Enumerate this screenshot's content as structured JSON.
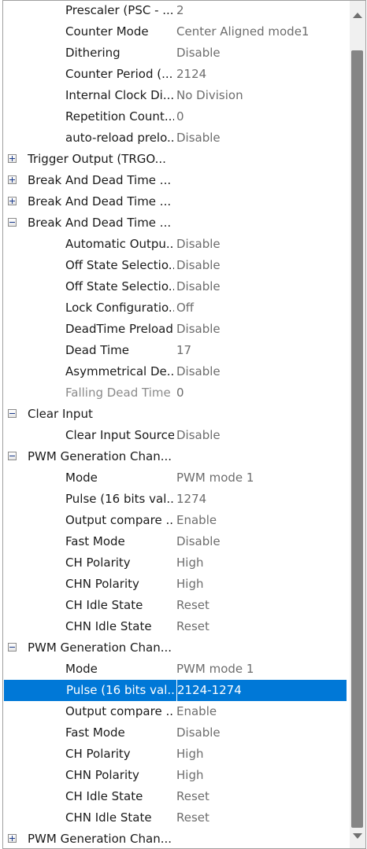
{
  "rows": [
    {
      "type": "prop",
      "label": "Prescaler (PSC - ...",
      "value": "2"
    },
    {
      "type": "prop",
      "label": "Counter Mode",
      "value": "Center Aligned mode1"
    },
    {
      "type": "prop",
      "label": "Dithering",
      "value": "Disable"
    },
    {
      "type": "prop",
      "label": "Counter Period (...",
      "value": "2124"
    },
    {
      "type": "prop",
      "label": "Internal Clock Di...",
      "value": "No Division"
    },
    {
      "type": "prop",
      "label": "Repetition Count...",
      "value": "0"
    },
    {
      "type": "prop",
      "label": "auto-reload prelo...",
      "value": "Disable"
    },
    {
      "type": "group",
      "label": "Trigger Output (TRGO...",
      "expanded": false
    },
    {
      "type": "group",
      "label": "Break And Dead Time ...",
      "expanded": false
    },
    {
      "type": "group",
      "label": "Break And Dead Time ...",
      "expanded": false
    },
    {
      "type": "group",
      "label": "Break And Dead Time ...",
      "expanded": true
    },
    {
      "type": "prop",
      "label": "Automatic Outpu...",
      "value": "Disable"
    },
    {
      "type": "prop",
      "label": "Off State Selectio...",
      "value": "Disable"
    },
    {
      "type": "prop",
      "label": "Off State Selectio...",
      "value": "Disable"
    },
    {
      "type": "prop",
      "label": "Lock Configuratio...",
      "value": "Off"
    },
    {
      "type": "prop",
      "label": "DeadTime Preload",
      "value": "Disable"
    },
    {
      "type": "prop",
      "label": "Dead Time",
      "value": "17"
    },
    {
      "type": "prop",
      "label": "Asymmetrical De...",
      "value": "Disable"
    },
    {
      "type": "prop",
      "label": "Falling Dead Time",
      "value": "0",
      "disabled": true
    },
    {
      "type": "group",
      "label": "Clear Input",
      "expanded": true
    },
    {
      "type": "prop",
      "label": "Clear Input Source",
      "value": "Disable"
    },
    {
      "type": "group",
      "label": "PWM Generation Chan...",
      "expanded": true
    },
    {
      "type": "prop",
      "label": "Mode",
      "value": "PWM mode 1"
    },
    {
      "type": "prop",
      "label": "Pulse (16 bits val...",
      "value": "1274"
    },
    {
      "type": "prop",
      "label": "Output compare ...",
      "value": "Enable"
    },
    {
      "type": "prop",
      "label": "Fast Mode",
      "value": "Disable"
    },
    {
      "type": "prop",
      "label": "CH Polarity",
      "value": "High"
    },
    {
      "type": "prop",
      "label": "CHN Polarity",
      "value": "High"
    },
    {
      "type": "prop",
      "label": "CH Idle State",
      "value": "Reset"
    },
    {
      "type": "prop",
      "label": "CHN Idle State",
      "value": "Reset"
    },
    {
      "type": "group",
      "label": "PWM Generation Chan...",
      "expanded": true
    },
    {
      "type": "prop",
      "label": "Mode",
      "value": "PWM mode 1"
    },
    {
      "type": "prop",
      "label": "Pulse (16 bits val...",
      "value": "2124-1274",
      "selected": true
    },
    {
      "type": "prop",
      "label": "Output compare ...",
      "value": "Enable"
    },
    {
      "type": "prop",
      "label": "Fast Mode",
      "value": "Disable"
    },
    {
      "type": "prop",
      "label": "CH Polarity",
      "value": "High"
    },
    {
      "type": "prop",
      "label": "CHN Polarity",
      "value": "High"
    },
    {
      "type": "prop",
      "label": "CH Idle State",
      "value": "Reset"
    },
    {
      "type": "prop",
      "label": "CHN Idle State",
      "value": "Reset"
    },
    {
      "type": "group",
      "label": "PWM Generation Chan...",
      "expanded": false
    }
  ],
  "colors": {
    "selection": "#0078d7",
    "value_text": "#6d6d6d",
    "disabled_text": "#8a8a8a"
  }
}
